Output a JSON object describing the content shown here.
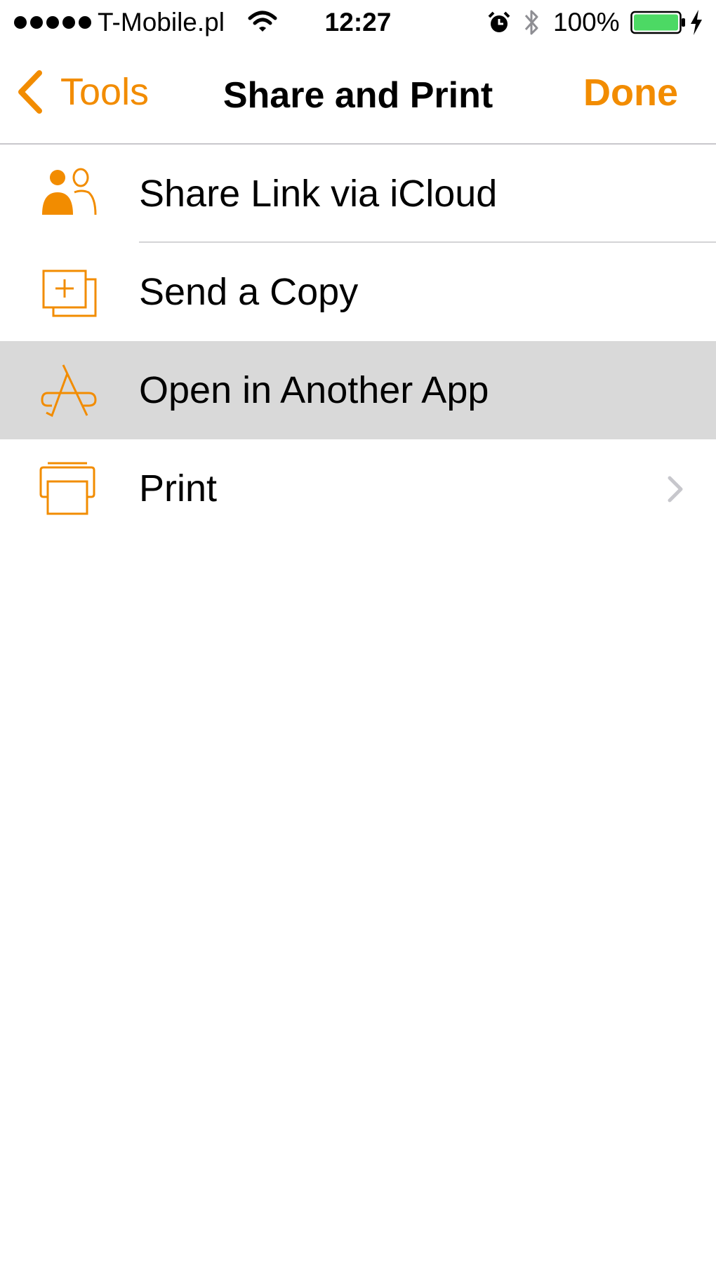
{
  "status_bar": {
    "carrier": "T-Mobile.pl",
    "time": "12:27",
    "battery_percent": "100%",
    "icons": [
      "signal-dots",
      "wifi-icon",
      "alarm-icon",
      "bluetooth-icon",
      "battery-icon",
      "charging-icon"
    ]
  },
  "nav": {
    "back_label": "Tools",
    "title": "Share and Print",
    "done_label": "Done",
    "accent_color": "#f28c00"
  },
  "items": [
    {
      "label": "Share Link via iCloud",
      "icon": "people-icon"
    },
    {
      "label": "Send a Copy",
      "icon": "copy-add-icon"
    },
    {
      "label": "Open in Another App",
      "icon": "app-store-icon",
      "highlighted": true
    },
    {
      "label": "Print",
      "icon": "printer-icon",
      "has_chevron": true
    }
  ]
}
